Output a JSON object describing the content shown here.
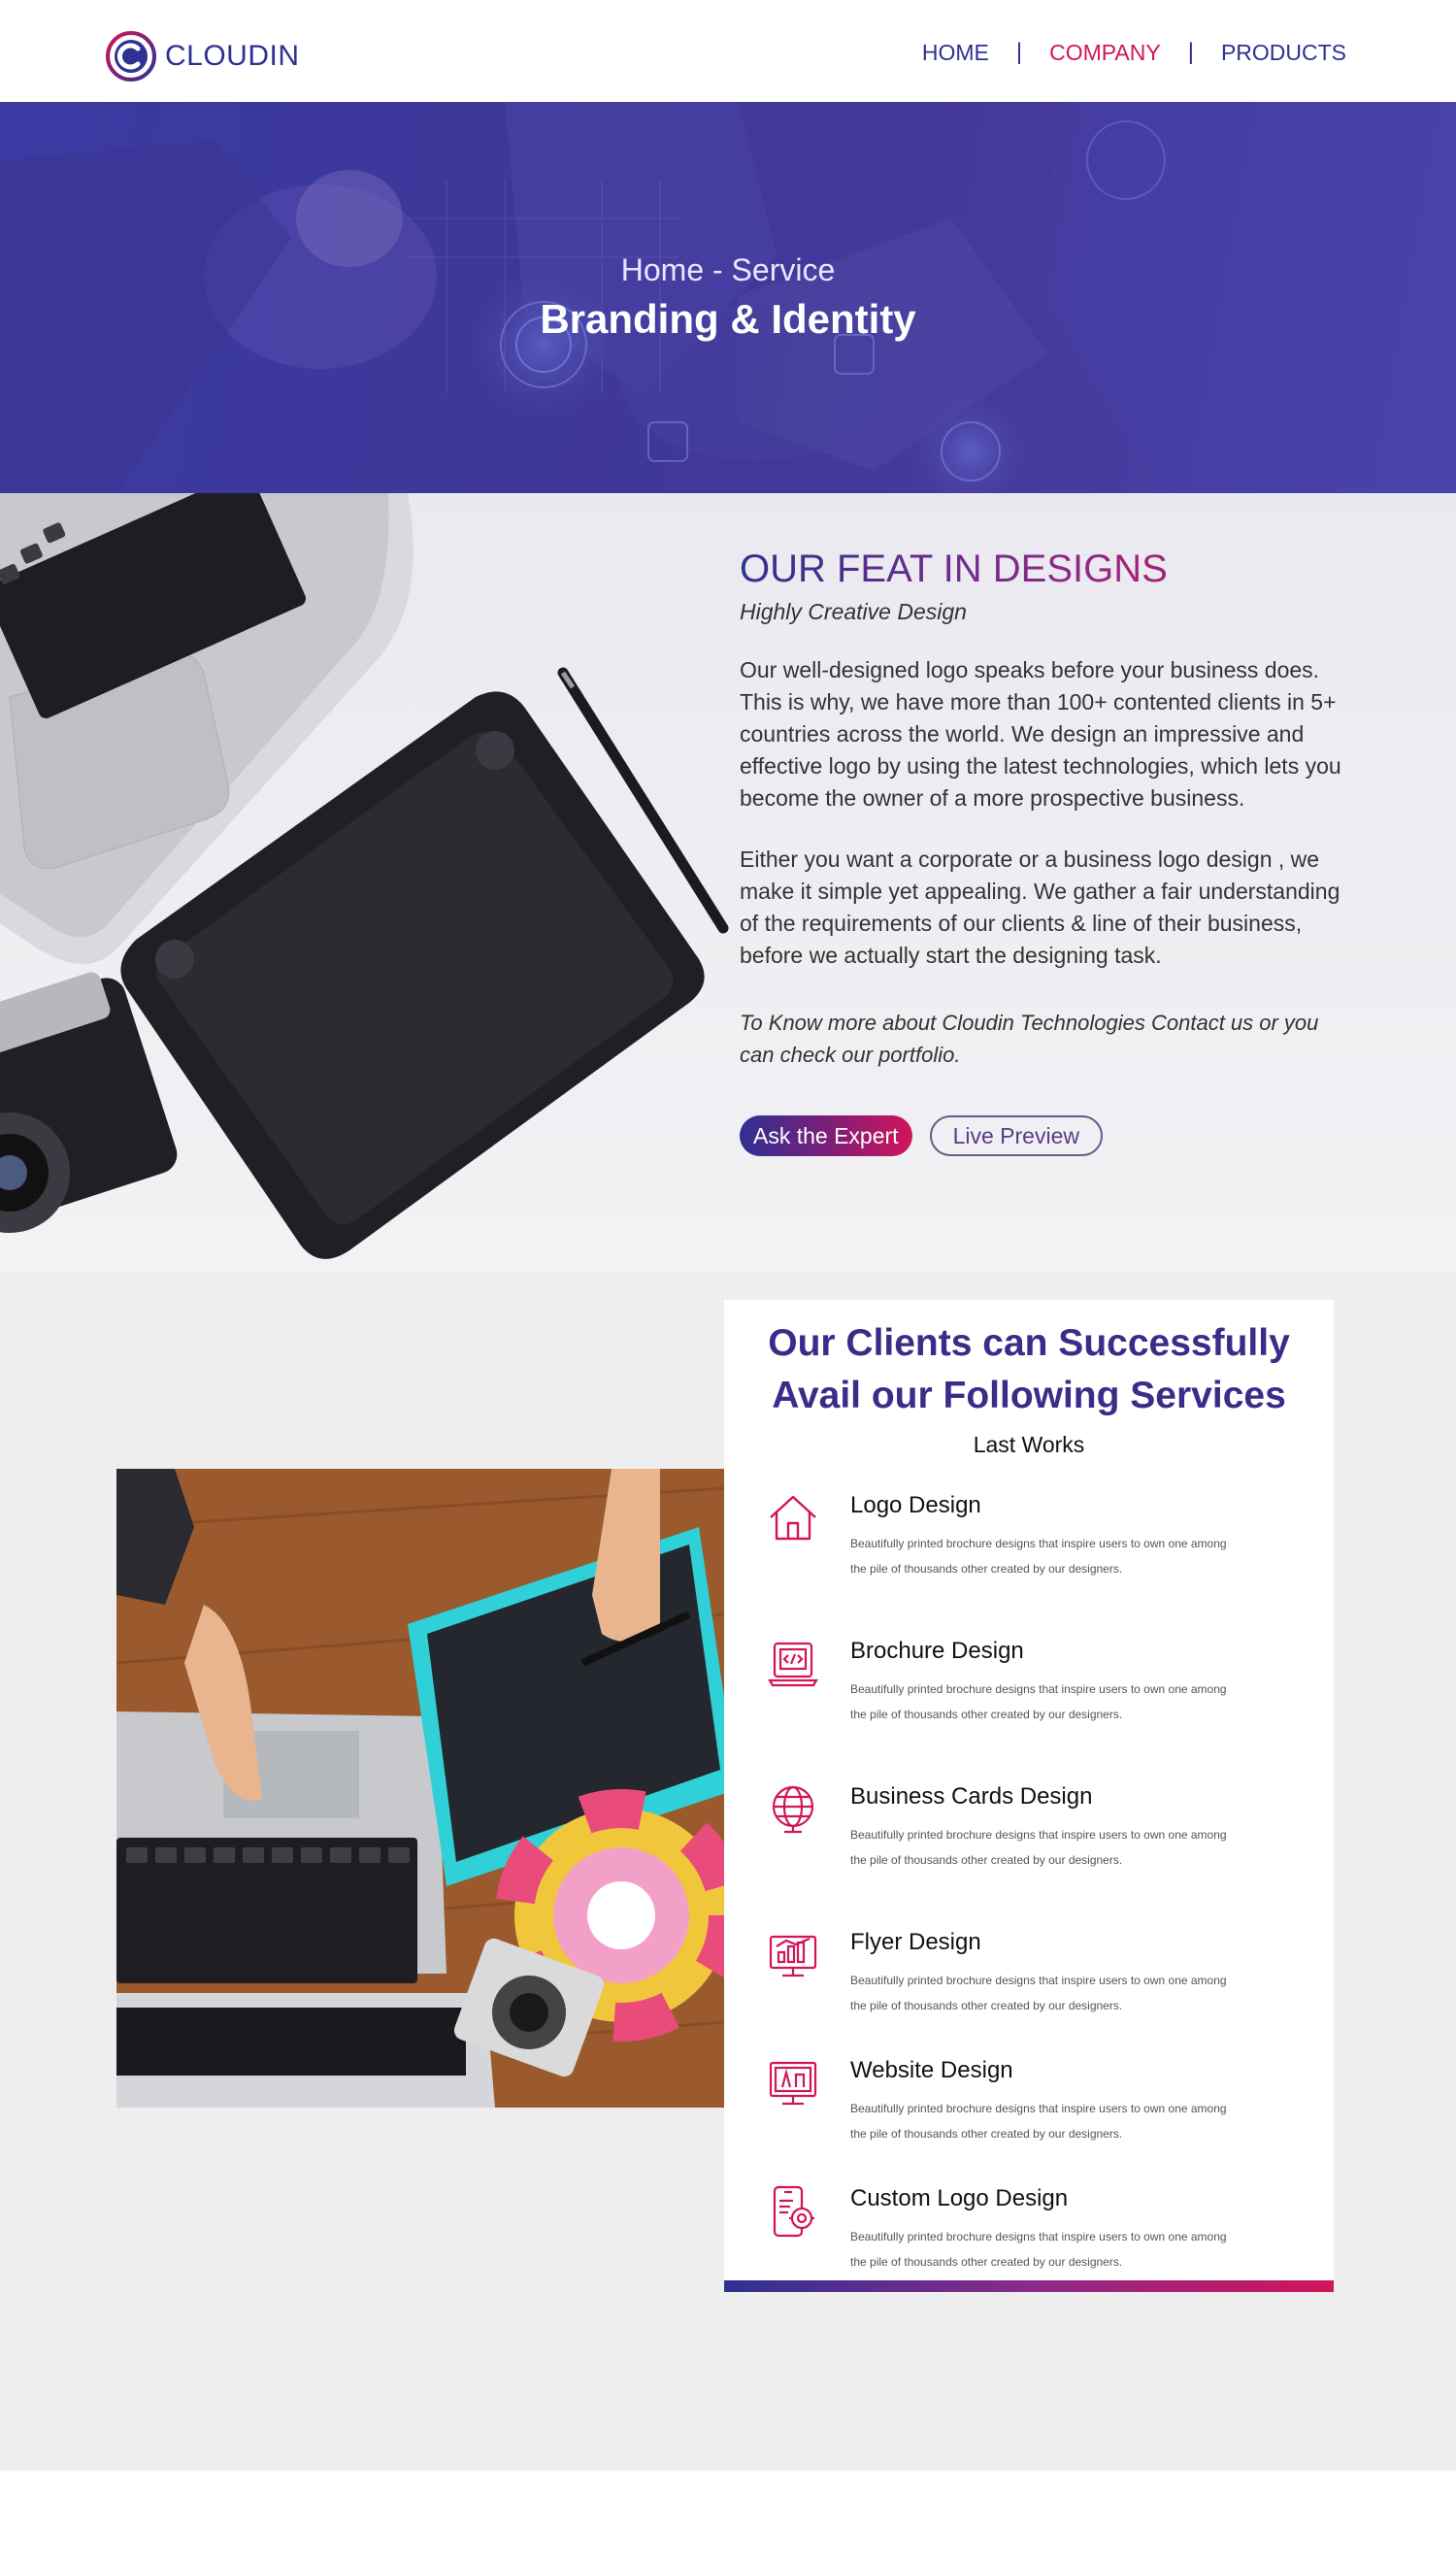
{
  "brand": {
    "name": "CLOUDIN"
  },
  "nav": {
    "items": [
      {
        "label": "HOME",
        "active": false
      },
      {
        "label": "COMPANY",
        "active": true
      },
      {
        "label": "PRODUCTS",
        "active": false
      }
    ],
    "separator": "|"
  },
  "hero": {
    "breadcrumb": "Home - Service",
    "title": "Branding & Identity"
  },
  "feat": {
    "title": "OUR FEAT IN DESIGNS",
    "subtitle": "Highly Creative Design",
    "paragraphs": [
      "Our well-designed logo speaks before your business does. This is why, we have more than 100+ contented clients in 5+ countries across the world. We design an impressive and effective logo by using the latest technologies, which lets you become the owner of a more prospective business.",
      "Either you want a corporate or a business logo design , we make it simple yet appealing. We gather a fair understanding of the requirements of our clients & line of their business, before we actually start the designing task."
    ],
    "note": "To Know more about Cloudin Technologies Contact us or you can check our portfolio.",
    "primary_button": "Ask the Expert",
    "secondary_button": "Live Preview"
  },
  "services": {
    "title_line1": "Our Clients can Successfully",
    "title_line2": "Avail our Following Services",
    "subtitle": "Last Works",
    "items": [
      {
        "name": "Logo Design",
        "icon": "home-icon",
        "desc": "Beautifully printed brochure designs that inspire users to own one among the pile of thousands other created by our designers."
      },
      {
        "name": "Brochure Design",
        "icon": "laptop-code-icon",
        "desc": "Beautifully printed brochure designs that inspire users to own one among the pile of thousands other created by our designers."
      },
      {
        "name": "Business Cards Design",
        "icon": "globe-icon",
        "desc": "Beautifully printed brochure designs that inspire users to own one among the pile of thousands other created by our designers."
      },
      {
        "name": "Flyer Design",
        "icon": "monitor-chart-icon",
        "desc": "Beautifully printed brochure designs that inspire users to own one among the pile of thousands other created by our designers."
      },
      {
        "name": "Website Design",
        "icon": "monitor-design-icon",
        "desc": "Beautifully printed brochure designs that inspire users to own one among the pile of thousands other created by our designers."
      },
      {
        "name": "Custom Logo Design",
        "icon": "mobile-settings-icon",
        "desc": "Beautifully printed brochure designs that inspire users to own one among the pile of thousands other created by our designers."
      }
    ]
  },
  "colors": {
    "brand_blue": "#2e3192",
    "brand_pink": "#d1155a",
    "hero_overlay": "#3f3798",
    "section_bg": "#efeeee"
  }
}
